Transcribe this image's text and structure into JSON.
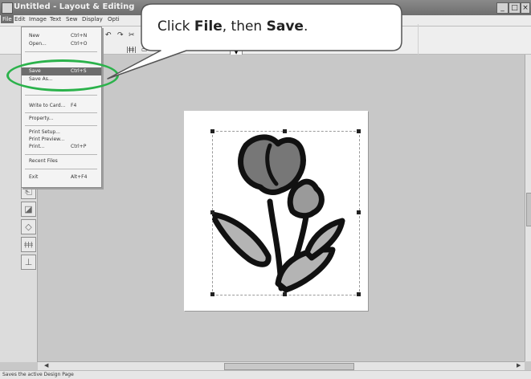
{
  "window": {
    "title": "Untitled - Layout & Editing"
  },
  "menubar": {
    "items": [
      "File",
      "Edit",
      "Image",
      "Text",
      "Sew",
      "Display",
      "Opti"
    ]
  },
  "toolbar": {
    "undo": "↶",
    "redo": "↷",
    "combo_arrow": "▼"
  },
  "file_menu": {
    "new": {
      "label": "New",
      "shortcut": "Ctrl+N"
    },
    "open": {
      "label": "Open...",
      "shortcut": "Ctrl+O"
    },
    "save": {
      "label": "Save",
      "shortcut": "Ctrl+S"
    },
    "save_as": {
      "label": "Save As..."
    },
    "write_to_card": {
      "label": "Write to Card...",
      "shortcut": "F4"
    },
    "property": {
      "label": "Property..."
    },
    "print_setup": {
      "label": "Print Setup..."
    },
    "print_preview": {
      "label": "Print Preview..."
    },
    "print": {
      "label": "Print...",
      "shortcut": "Ctrl+P"
    },
    "recent_files": {
      "label": "Recent Files"
    },
    "exit": {
      "label": "Exit",
      "shortcut": "Alt+F4"
    }
  },
  "callout": {
    "prefix": "Click ",
    "file": "File",
    "middle": ", then ",
    "save": "Save",
    "suffix": "."
  },
  "statusbar": {
    "text": "Saves the active Design Page"
  },
  "colors": {
    "highlight_ring": "#2bb24b",
    "menu_active": "#6d6d6d",
    "workspace": "#c8c8c8"
  },
  "icons": [
    "app-icon",
    "minimize-icon",
    "maximize-icon",
    "close-icon",
    "tulip-embroidery-design"
  ]
}
